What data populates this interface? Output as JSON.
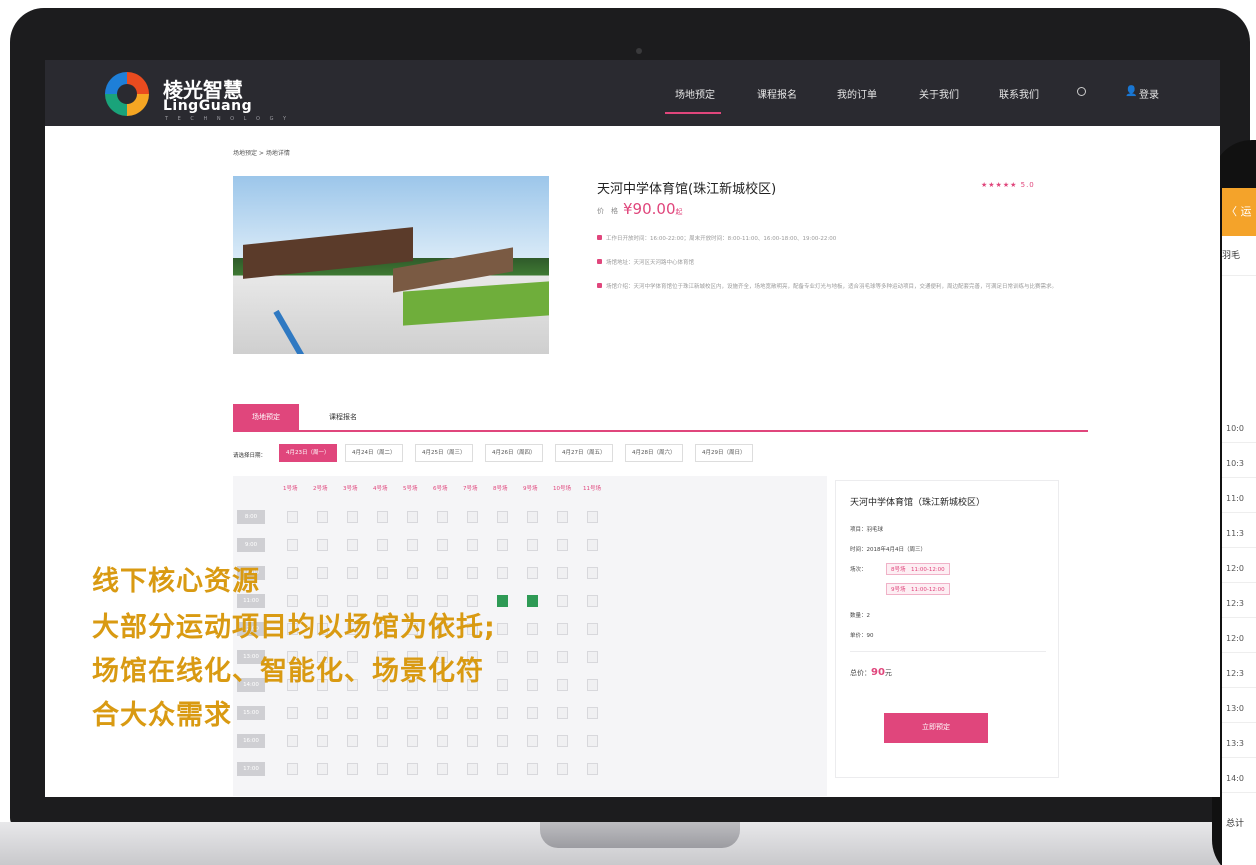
{
  "brand": {
    "name_cn": "棱光智慧",
    "name_en": "LingGuang",
    "tagline": "T E C H N O L O G Y"
  },
  "nav": {
    "items": [
      "场地预定",
      "课程报名",
      "我的订单",
      "关于我们",
      "联系我们"
    ],
    "active": 0,
    "login": "登录"
  },
  "breadcrumb": "场地预定 > 场地详情",
  "venue": {
    "title": "天河中学体育馆(珠江新城校区)",
    "rating_stars": "★★★★★",
    "rating": "5.0",
    "price_label": "价　格",
    "price": "¥90.00",
    "price_unit": "起",
    "hours": "工作日开放时间：16:00-22:00；周末开放时间：8:00-11:00、16:00-18:00、19:00-22:00",
    "address": "场馆地址：天河区天河路中心体育馆",
    "intro": "场馆介绍：天河中学体育馆位于珠江新城校区内，设施齐全，场地宽敞明亮，配备专业灯光与地板，适合羽毛球等多种运动项目，交通便利，周边配套完善，可满足日常训练与比赛需求。"
  },
  "tabs": [
    "场地预定",
    "课程报名"
  ],
  "dates": {
    "label": "请选择日期：",
    "items": [
      "4月23日（周一）",
      "4月24日（周二）",
      "4月25日（周三）",
      "4月26日（周四）",
      "4月27日（周五）",
      "4月28日（周六）",
      "4月29日（周日）"
    ],
    "active": 0
  },
  "courts": [
    "1号场",
    "2号场",
    "3号场",
    "4号场",
    "5号场",
    "6号场",
    "7号场",
    "8号场",
    "9号场",
    "10号场",
    "11号场"
  ],
  "times": [
    "8:00",
    "9:00",
    "10:00",
    "11:00",
    "12:00",
    "13:00",
    "14:00",
    "15:00",
    "16:00",
    "17:00"
  ],
  "order": {
    "title": "天河中学体育馆（珠江新城校区）",
    "item": "项目：羽毛球",
    "time": "时间：2018年4月4日（周三）",
    "courts_label": "场次：",
    "courts": [
      "8号场　11:00-12:00",
      "9号场　11:00-12:00"
    ],
    "qty": "数量：2",
    "unit_price": "单价：90",
    "total_label": "总价：",
    "total": "90",
    "total_unit": "元",
    "button": "立即预定"
  },
  "overlay": [
    "线下核心资源",
    "大部分运动项目均以场馆为依托;",
    "场馆在线化、智能化、场景化符",
    "合大众需求"
  ],
  "phone": {
    "header": "〈 运",
    "sub": "羽毛",
    "times": [
      "10:0",
      "10:3",
      "11:0",
      "11:3",
      "12:0",
      "12:3",
      "12:0",
      "12:3",
      "13:0",
      "13:3",
      "14:0"
    ],
    "total": "总计"
  },
  "colors": {
    "accent": "#e0467c",
    "overlay": "#d99a12",
    "nav_bg": "#2a2a30",
    "selected_cell": "#2e9a55"
  }
}
